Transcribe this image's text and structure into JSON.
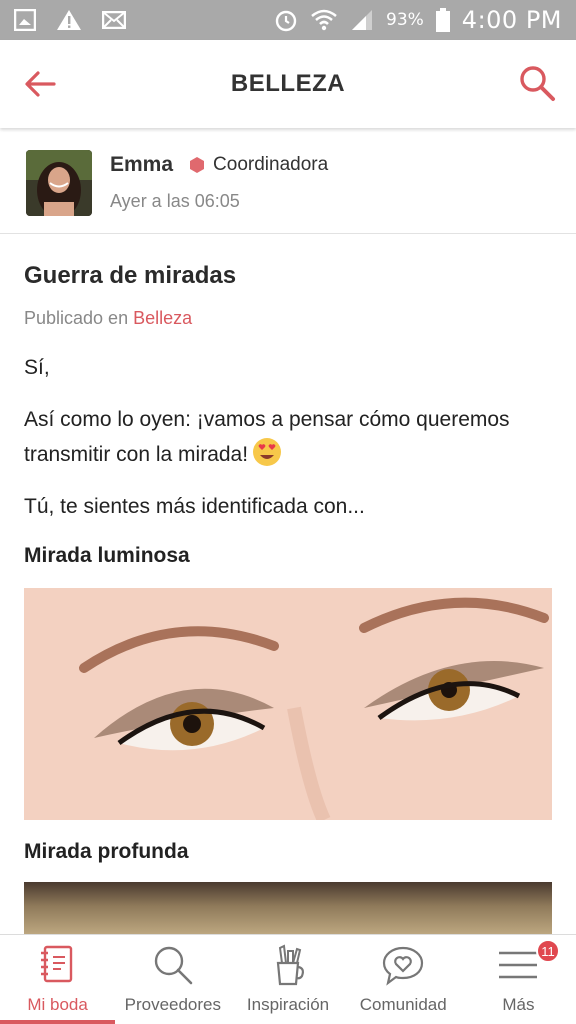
{
  "status_bar": {
    "battery": "93%",
    "time": "4:00 PM",
    "icons": [
      "gallery-icon",
      "warning-icon",
      "mail-icon",
      "alarm-icon",
      "wifi-icon",
      "signal-icon",
      "battery-icon"
    ]
  },
  "app_bar": {
    "title": "BELLEZA",
    "back_icon": "arrow-left-icon",
    "search_icon": "search-icon",
    "accent_color": "#d9595f"
  },
  "author": {
    "name": "Emma",
    "role": "Coordinadora",
    "time": "Ayer a las 06:05"
  },
  "post": {
    "title": "Guerra de miradas",
    "meta_prefix": "Publicado en",
    "meta_category": "Belleza",
    "p1": "Sí,",
    "p2": "Así como lo oyen: ¡vamos a pensar cómo queremos transmitir con la mirada!",
    "p3": "Tú, te sientes más identificada con...",
    "section1": "Mirada luminosa",
    "section2": "Mirada profunda"
  },
  "bottom_nav": {
    "items": [
      {
        "label": "Mi boda",
        "icon": "notebook-icon",
        "active": true
      },
      {
        "label": "Proveedores",
        "icon": "search-icon"
      },
      {
        "label": "Inspiración",
        "icon": "pencil-cup-icon"
      },
      {
        "label": "Comunidad",
        "icon": "chat-heart-icon"
      },
      {
        "label": "Más",
        "icon": "menu-icon",
        "badge": "11"
      }
    ]
  }
}
